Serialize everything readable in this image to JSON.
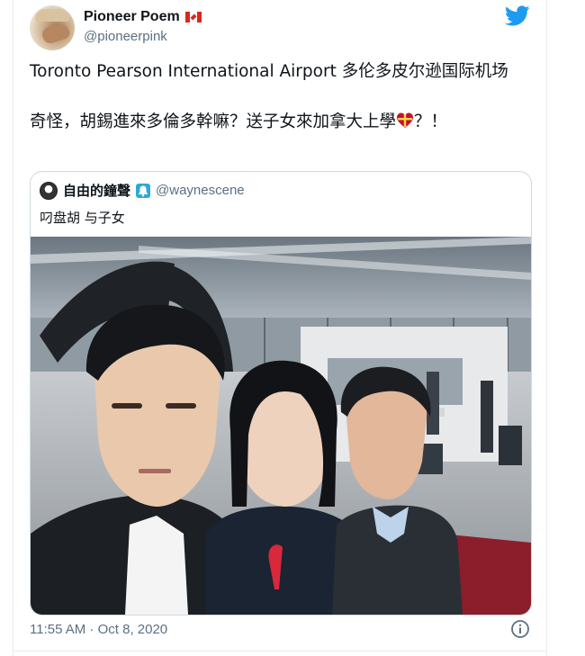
{
  "author": {
    "display_name": "Pioneer Poem",
    "handle": "@pioneerpink",
    "flag_icon": "canada-flag-icon"
  },
  "tweet": {
    "line1": "Toronto Pearson International Airport 多伦多皮尔逊国际机场",
    "line2_prefix": "奇怪，胡錫進來多倫多幹嘛？送子女來加拿大上學",
    "line2_suffix": "？！",
    "emoji": "gift-heart-emoji"
  },
  "quoted_tweet": {
    "display_name": "自由的鐘聲",
    "handle": "@waynescene",
    "text": "叼盘胡 与子女",
    "name_emoji": "bell-icon"
  },
  "meta": {
    "timestamp": "11:55 AM · Oct 8, 2020"
  },
  "colors": {
    "twitter_blue": "#1d9bf0",
    "secondary_text": "#5b7083",
    "border": "#cfd9de"
  }
}
